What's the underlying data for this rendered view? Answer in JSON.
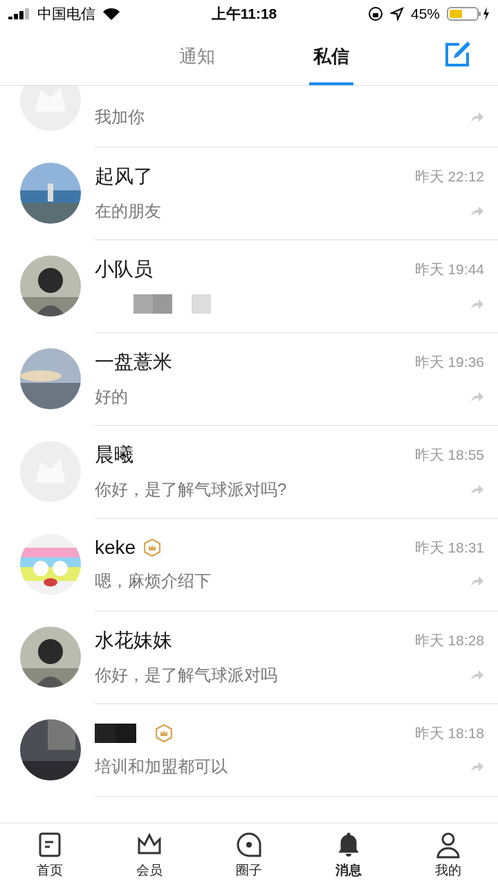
{
  "status_bar": {
    "carrier": "中国电信",
    "time": "上午11:18",
    "battery": "45%"
  },
  "tabs": [
    {
      "label": "通知",
      "selected": false
    },
    {
      "label": "私信",
      "selected": true
    }
  ],
  "conversations": [
    {
      "avatar": {
        "kind": "default"
      },
      "message": "我加你"
    },
    {
      "avatar": {
        "kind": "sea"
      },
      "name": "起风了",
      "time": "昨天 22:12",
      "message": "在的朋友"
    },
    {
      "avatar": {
        "kind": "person"
      },
      "name": "小队员",
      "time": "昨天 19:44",
      "message_redacted": true
    },
    {
      "avatar": {
        "kind": "sky"
      },
      "name": "一盘薏米",
      "time": "昨天 19:36",
      "message": "好的"
    },
    {
      "avatar": {
        "kind": "default"
      },
      "name": "晨曦",
      "time": "昨天 18:55",
      "message": "你好，是了解气球派对吗?"
    },
    {
      "avatar": {
        "kind": "cartoon"
      },
      "name": "keke",
      "badge": true,
      "time": "昨天 18:31",
      "message": "嗯，麻烦介绍下"
    },
    {
      "avatar": {
        "kind": "person"
      },
      "name": "水花妹妹",
      "time": "昨天 18:28",
      "message": "你好，是了解气球派对吗"
    },
    {
      "avatar": {
        "kind": "dark"
      },
      "name_redacted": true,
      "badge": true,
      "time": "昨天 18:18",
      "message": "培训和加盟都可以"
    }
  ],
  "nav": [
    {
      "label": "首页",
      "selected": false
    },
    {
      "label": "会员",
      "selected": false
    },
    {
      "label": "圈子",
      "selected": false
    },
    {
      "label": "消息",
      "selected": true
    },
    {
      "label": "我的",
      "selected": false
    }
  ]
}
